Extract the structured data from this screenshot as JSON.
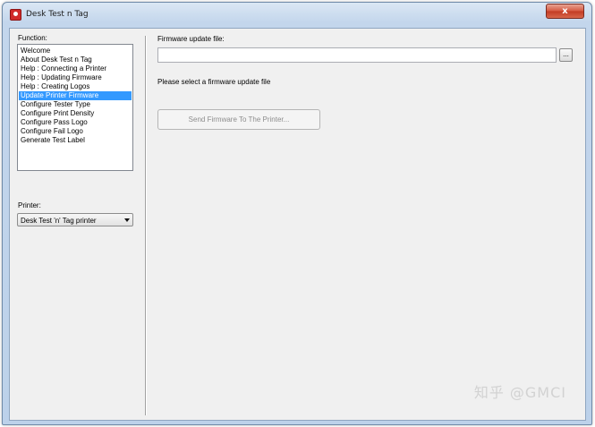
{
  "window": {
    "title": "Desk Test n Tag",
    "close_label": "x"
  },
  "left": {
    "function_label": "Function:",
    "functions": [
      "Welcome",
      "About Desk Test n Tag",
      "Help : Connecting a Printer",
      "Help : Updating Firmware",
      "Help : Creating Logos",
      "Update Printer Firmware",
      "Configure Tester Type",
      "Configure Print Density",
      "Configure Pass Logo",
      "Configure Fail Logo",
      "Generate Test Label"
    ],
    "selected_index": 5,
    "printer_label": "Printer:",
    "printer_value": "Desk Test 'n' Tag printer"
  },
  "main": {
    "firmware_label": "Firmware update file:",
    "firmware_value": "",
    "browse_label": "...",
    "hint": "Please select a firmware update file",
    "send_button": "Send Firmware To The Printer..."
  },
  "watermark": "知乎 @GMCI",
  "colors": {
    "selection": "#3399ff",
    "close_button": "#c9472e"
  }
}
